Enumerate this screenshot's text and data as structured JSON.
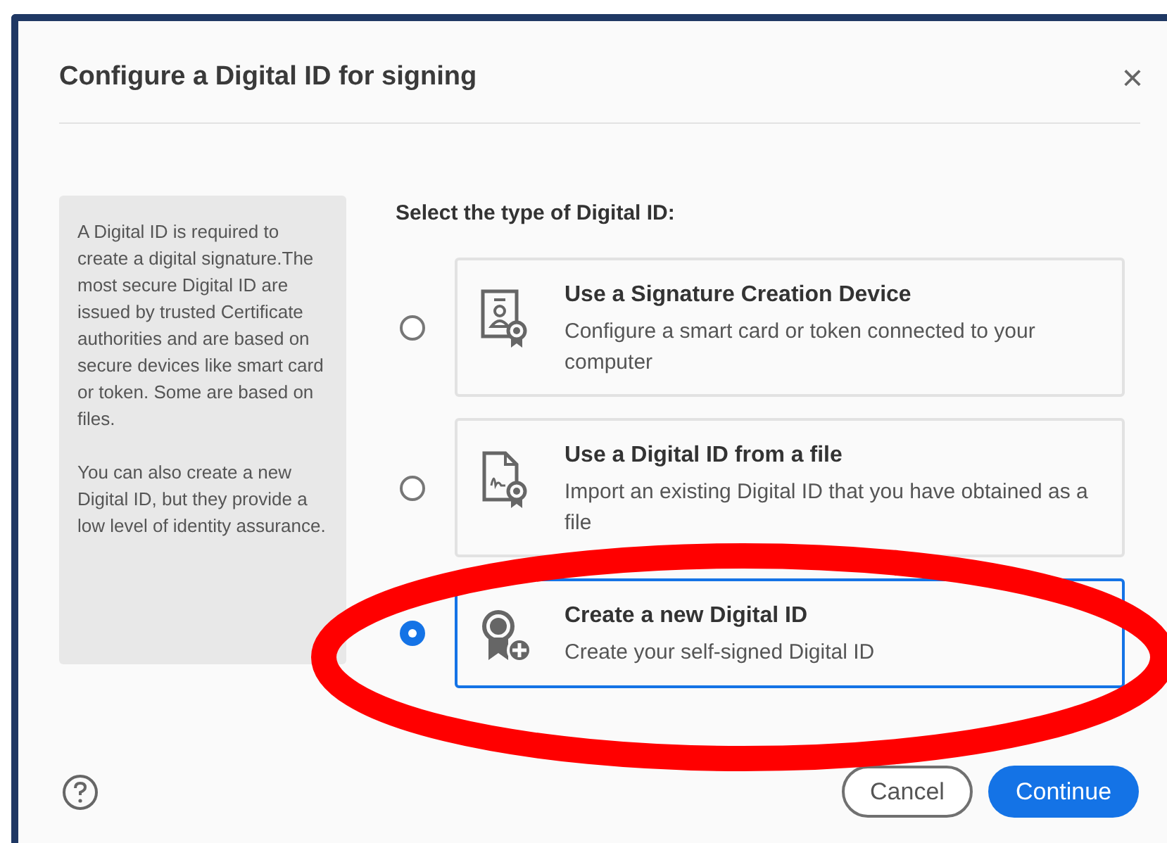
{
  "dialog": {
    "title": "Configure a Digital ID for signing",
    "close": "×"
  },
  "info": {
    "paragraphs": [
      "A Digital ID is required to create a digital signature.The most secure Digital ID are issued by trusted Certificate authorities and are based on secure devices like smart card or token. Some are based on files.",
      "You can also create a new Digital ID, but they provide a low level of identity assurance."
    ]
  },
  "prompt": "Select the type of Digital ID:",
  "options": [
    {
      "title": "Use a Signature Creation Device",
      "description": "Configure a smart card or token connected to your computer",
      "selected": false
    },
    {
      "title": "Use a Digital ID from a file",
      "description": "Import an existing Digital ID that you have obtained as a file",
      "selected": false
    },
    {
      "title": "Create a new Digital ID",
      "description": "Create your self-signed Digital ID",
      "selected": true
    }
  ],
  "buttons": {
    "cancel": "Cancel",
    "continue": "Continue"
  }
}
